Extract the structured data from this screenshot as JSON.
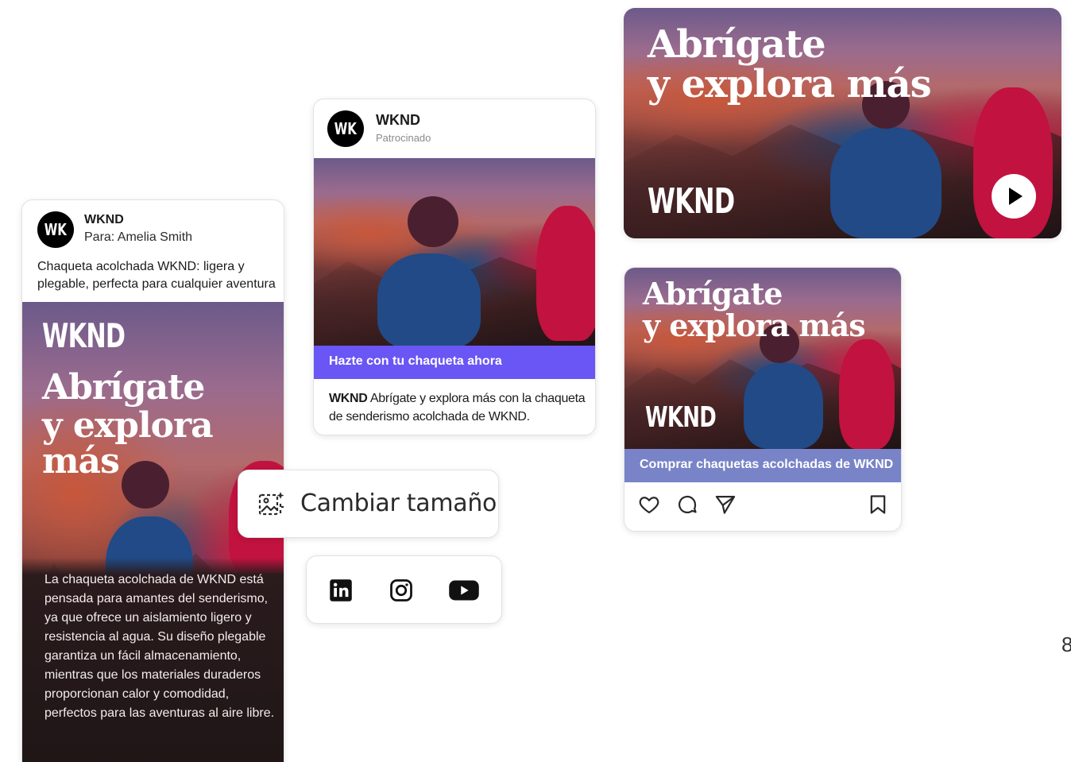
{
  "email_card": {
    "avatar": "WK",
    "sender": "WKND",
    "to": "Para: Amelia Smith",
    "subject": "Chaqueta acolchada WKND: ligera y plegable, perfecta para cualquier aventura",
    "brand": "WKND",
    "headline_line1": "Abrígate",
    "headline_line2": "y explora más",
    "body": "La chaqueta acolchada de WKND está pensada para amantes del senderismo, ya que ofrece un aislamiento ligero y resistencia al agua. Su diseño plegable garantiza un fácil almacenamiento, mientras que los materiales duraderos proporcionan calor y comodidad, perfectos para las aventuras al aire libre."
  },
  "social_post": {
    "avatar": "WK",
    "name": "WKND",
    "sponsored": "Patrocinado",
    "cta": "Hazte con tu chaqueta ahora",
    "caption_brand": "WKND",
    "caption": "Abrígate y explora más con la chaqueta de senderismo acolchada de WKND."
  },
  "video_card": {
    "headline_line1": "Abrígate",
    "headline_line2": "y explora más",
    "brand": "WKND",
    "icon": "play-icon"
  },
  "instagram_card": {
    "headline_line1": "Abrígate",
    "headline_line2": "y explora más",
    "brand": "WKND",
    "cta": "Comprar chaquetas acolchadas de WKND",
    "icons": [
      "heart-icon",
      "comment-icon",
      "send-icon",
      "bookmark-icon"
    ]
  },
  "resize_pill": {
    "label": "Cambiar tamaño",
    "icon": "resize-image-icon"
  },
  "social_pill": {
    "icons": [
      "linkedin-icon",
      "instagram-icon",
      "youtube-icon"
    ]
  },
  "edge_text": "8",
  "colors": {
    "cta_purple": "#6a55f5",
    "cta_lavender": "#7884c7",
    "dark_panel": "#1f1616"
  }
}
